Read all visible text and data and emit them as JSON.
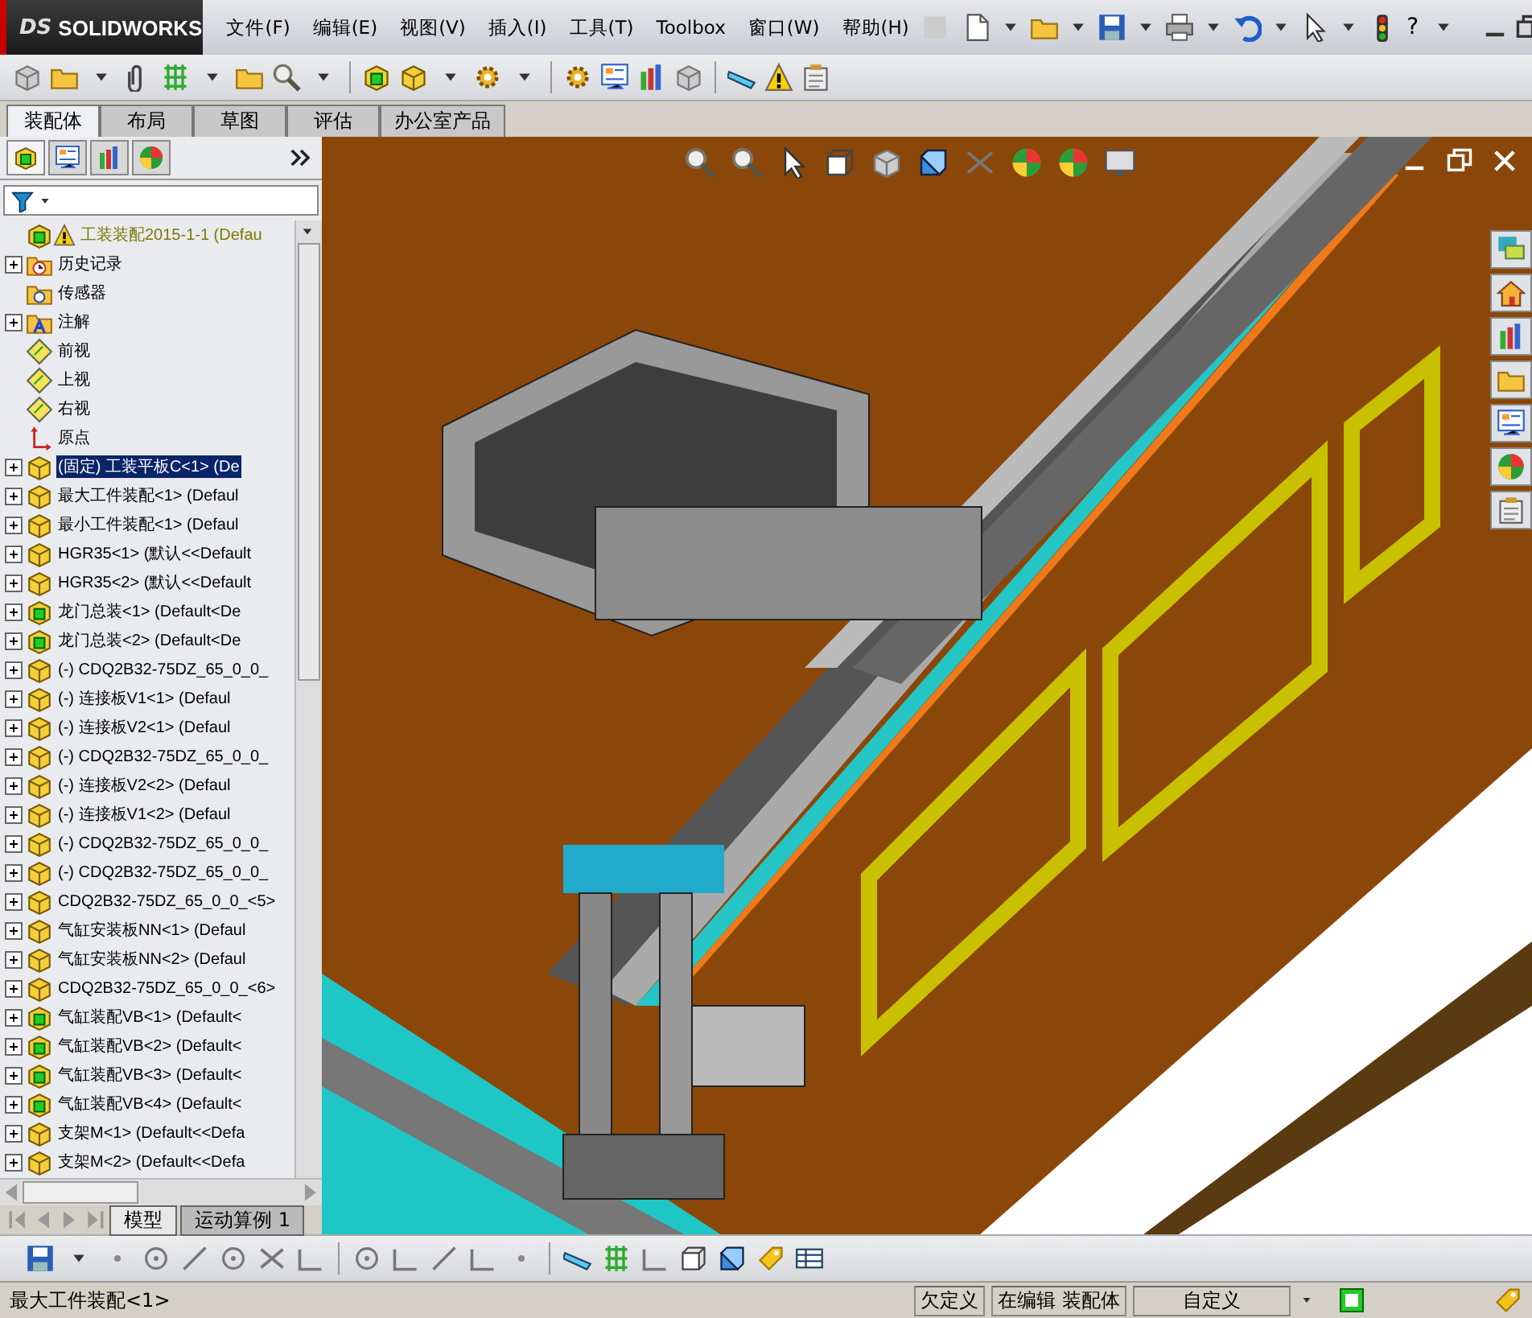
{
  "app": {
    "logo_mark": "DS",
    "logo_text": "SOLIDWORKS",
    "help_glyph": "?"
  },
  "menu": [
    "文件(F)",
    "编辑(E)",
    "视图(V)",
    "插入(I)",
    "工具(T)",
    "Toolbox",
    "窗口(W)",
    "帮助(H)"
  ],
  "command_tabs": [
    {
      "label": "装配体",
      "selected": true
    },
    {
      "label": "布局",
      "selected": false
    },
    {
      "label": "草图",
      "selected": false
    },
    {
      "label": "评估",
      "selected": false
    },
    {
      "label": "办公室产品",
      "selected": false
    }
  ],
  "panel_tabs": [
    {
      "kind": "tree",
      "selected": true
    },
    {
      "kind": "properties",
      "selected": false
    },
    {
      "kind": "config",
      "selected": false
    },
    {
      "kind": "display",
      "selected": false
    }
  ],
  "tree": [
    {
      "kind": "root",
      "label": "工装装配2015-1-1  (Defau",
      "expander": false,
      "selected": false
    },
    {
      "kind": "history",
      "label": "历史记录",
      "expander": true,
      "selected": false
    },
    {
      "kind": "sensor",
      "label": "传感器",
      "expander": false,
      "selected": false
    },
    {
      "kind": "annotation",
      "label": "注解",
      "expander": true,
      "selected": false
    },
    {
      "kind": "plane",
      "label": "前视",
      "expander": false,
      "selected": false
    },
    {
      "kind": "plane",
      "label": "上视",
      "expander": false,
      "selected": false
    },
    {
      "kind": "plane",
      "label": "右视",
      "expander": false,
      "selected": false
    },
    {
      "kind": "origin",
      "label": "原点",
      "expander": false,
      "selected": false
    },
    {
      "kind": "part",
      "label": "(固定) 工装平板C<1> (De",
      "expander": true,
      "selected": true
    },
    {
      "kind": "part",
      "label": "最大工件装配<1> (Defaul",
      "expander": true,
      "selected": false
    },
    {
      "kind": "part",
      "label": "最小工件装配<1> (Defaul",
      "expander": true,
      "selected": false
    },
    {
      "kind": "part",
      "label": "HGR35<1> (默认<<Default",
      "expander": true,
      "selected": false
    },
    {
      "kind": "part",
      "label": "HGR35<2> (默认<<Default",
      "expander": true,
      "selected": false
    },
    {
      "kind": "subassembly",
      "label": "龙门总装<1> (Default<De",
      "expander": true,
      "selected": false
    },
    {
      "kind": "subassembly",
      "label": "龙门总装<2> (Default<De",
      "expander": true,
      "selected": false
    },
    {
      "kind": "part",
      "label": "(-) CDQ2B32-75DZ_65_0_0_",
      "expander": true,
      "selected": false
    },
    {
      "kind": "part",
      "label": "(-) 连接板V1<1> (Defaul",
      "expander": true,
      "selected": false
    },
    {
      "kind": "part",
      "label": "(-) 连接板V2<1> (Defaul",
      "expander": true,
      "selected": false
    },
    {
      "kind": "part",
      "label": "(-) CDQ2B32-75DZ_65_0_0_",
      "expander": true,
      "selected": false
    },
    {
      "kind": "part",
      "label": "(-) 连接板V2<2> (Defaul",
      "expander": true,
      "selected": false
    },
    {
      "kind": "part",
      "label": "(-) 连接板V1<2> (Defaul",
      "expander": true,
      "selected": false
    },
    {
      "kind": "part",
      "label": "(-) CDQ2B32-75DZ_65_0_0_",
      "expander": true,
      "selected": false
    },
    {
      "kind": "part",
      "label": "(-) CDQ2B32-75DZ_65_0_0_",
      "expander": true,
      "selected": false
    },
    {
      "kind": "part",
      "label": "CDQ2B32-75DZ_65_0_0_<5>",
      "expander": true,
      "selected": false
    },
    {
      "kind": "part",
      "label": "气缸安装板NN<1> (Defaul",
      "expander": true,
      "selected": false
    },
    {
      "kind": "part",
      "label": "气缸安装板NN<2> (Defaul",
      "expander": true,
      "selected": false
    },
    {
      "kind": "part",
      "label": "CDQ2B32-75DZ_65_0_0_<6>",
      "expander": true,
      "selected": false
    },
    {
      "kind": "subassembly",
      "label": "气缸装配VB<1> (Default<",
      "expander": true,
      "selected": false
    },
    {
      "kind": "subassembly",
      "label": "气缸装配VB<2> (Default<",
      "expander": true,
      "selected": false
    },
    {
      "kind": "subassembly",
      "label": "气缸装配VB<3> (Default<",
      "expander": true,
      "selected": false
    },
    {
      "kind": "subassembly",
      "label": "气缸装配VB<4> (Default<",
      "expander": true,
      "selected": false
    },
    {
      "kind": "part",
      "label": "支架M<1> (Default<<Defa",
      "expander": true,
      "selected": false
    },
    {
      "kind": "part",
      "label": "支架M<2> (Default<<Defa",
      "expander": true,
      "selected": false
    }
  ],
  "bottom_tabs": [
    {
      "label": "模型",
      "selected": true
    },
    {
      "label": "运动算例 1",
      "selected": false
    }
  ],
  "status_bar": {
    "message": "最大工件装配<1>",
    "state": "欠定义",
    "mode": "在编辑 装配体",
    "units": "自定义"
  }
}
